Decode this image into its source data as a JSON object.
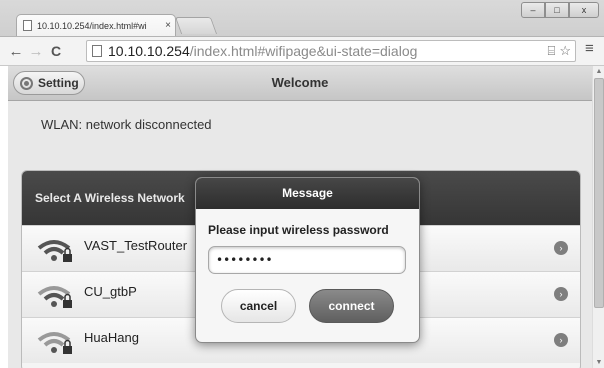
{
  "browser": {
    "tab_title": "10.10.10.254/index.html#wi",
    "tab_close": "×",
    "url_host": "10.10.10.254",
    "url_path": "/index.html#wifipage&ui-state=dialog",
    "window_controls": {
      "minimize": "–",
      "maximize": "□",
      "close": "x"
    }
  },
  "header": {
    "setting_label": "Setting",
    "title": "Welcome"
  },
  "status": {
    "wlan": "WLAN: network disconnected"
  },
  "network_list": {
    "heading": "Select A Wireless Network",
    "items": [
      {
        "name": "VAST_TestRouter",
        "locked": true
      },
      {
        "name": "CU_gtbP",
        "locked": true
      },
      {
        "name": "HuaHang",
        "locked": true
      }
    ]
  },
  "dialog": {
    "title": "Message",
    "prompt": "Please input wireless password",
    "password_value": "••••••••",
    "cancel_label": "cancel",
    "connect_label": "connect"
  },
  "colors": {
    "header_dark": "#363636",
    "connect_button": "#6b6b6b"
  }
}
